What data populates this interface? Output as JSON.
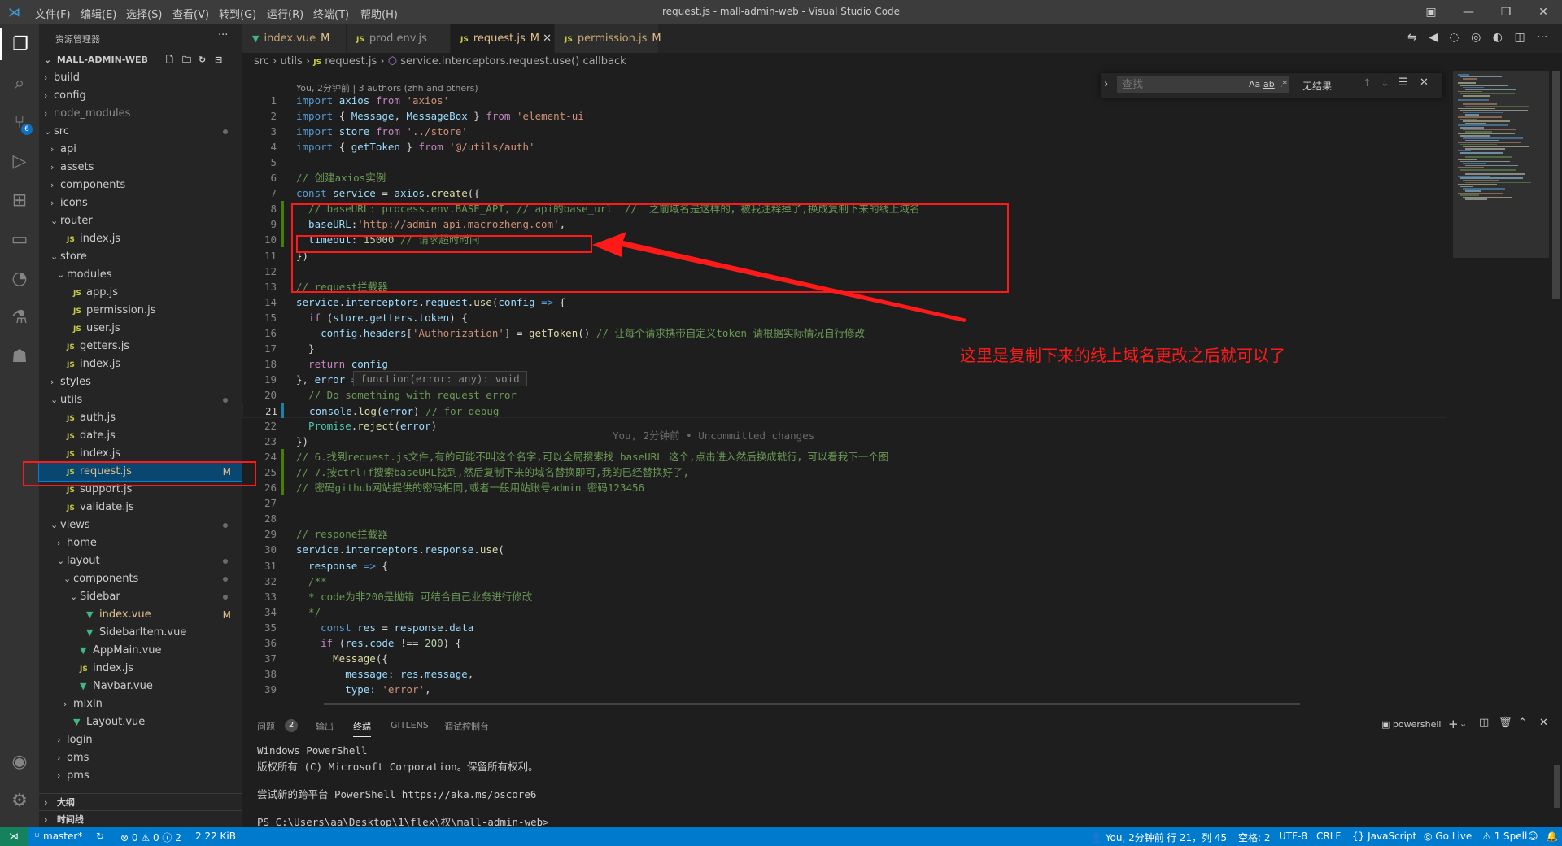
{
  "titlebar": {
    "menu": [
      "文件(F)",
      "编辑(E)",
      "选择(S)",
      "查看(V)",
      "转到(G)",
      "运行(R)",
      "终端(T)",
      "帮助(H)"
    ],
    "title": "request.js - mall-admin-web - Visual Studio Code"
  },
  "activitybar": {
    "icons": [
      "explorer-icon",
      "search-icon",
      "source-control-icon",
      "run-debug-icon",
      "extensions-icon",
      "remote-explorer-icon",
      "gitlens-icon",
      "testing-icon",
      "docker-icon"
    ],
    "scm_badge": "6",
    "bottom_icons": [
      "account-icon",
      "manage-gear-icon"
    ]
  },
  "sidebar": {
    "title": "资源管理器",
    "root": "MALL-ADMIN-WEB",
    "items": [
      {
        "label": "build",
        "depth": 1,
        "type": "folder",
        "open": false
      },
      {
        "label": "config",
        "depth": 1,
        "type": "folder",
        "open": false
      },
      {
        "label": "node_modules",
        "depth": 1,
        "type": "folder",
        "open": false,
        "dim": true
      },
      {
        "label": "src",
        "depth": 1,
        "type": "folder",
        "open": true,
        "dot": true
      },
      {
        "label": "api",
        "depth": 2,
        "type": "folder",
        "open": false
      },
      {
        "label": "assets",
        "depth": 2,
        "type": "folder",
        "open": false
      },
      {
        "label": "components",
        "depth": 2,
        "type": "folder",
        "open": false
      },
      {
        "label": "icons",
        "depth": 2,
        "type": "folder",
        "open": false
      },
      {
        "label": "router",
        "depth": 2,
        "type": "folder",
        "open": true
      },
      {
        "label": "index.js",
        "depth": 3,
        "type": "js"
      },
      {
        "label": "store",
        "depth": 2,
        "type": "folder",
        "open": true
      },
      {
        "label": "modules",
        "depth": 3,
        "type": "folder",
        "open": true
      },
      {
        "label": "app.js",
        "depth": 4,
        "type": "js"
      },
      {
        "label": "permission.js",
        "depth": 4,
        "type": "js"
      },
      {
        "label": "user.js",
        "depth": 4,
        "type": "js"
      },
      {
        "label": "getters.js",
        "depth": 3,
        "type": "js"
      },
      {
        "label": "index.js",
        "depth": 3,
        "type": "js"
      },
      {
        "label": "styles",
        "depth": 2,
        "type": "folder",
        "open": false
      },
      {
        "label": "utils",
        "depth": 2,
        "type": "folder",
        "open": true,
        "dot": true
      },
      {
        "label": "auth.js",
        "depth": 3,
        "type": "js"
      },
      {
        "label": "date.js",
        "depth": 3,
        "type": "js"
      },
      {
        "label": "index.js",
        "depth": 3,
        "type": "js"
      },
      {
        "label": "request.js",
        "depth": 3,
        "type": "js",
        "status": "M",
        "selected": true
      },
      {
        "label": "support.js",
        "depth": 3,
        "type": "js"
      },
      {
        "label": "validate.js",
        "depth": 3,
        "type": "js"
      },
      {
        "label": "views",
        "depth": 2,
        "type": "folder",
        "open": true,
        "dot": true
      },
      {
        "label": "home",
        "depth": 3,
        "type": "folder",
        "open": false
      },
      {
        "label": "layout",
        "depth": 3,
        "type": "folder",
        "open": true,
        "dot": true
      },
      {
        "label": "components",
        "depth": 4,
        "type": "folder",
        "open": true,
        "dot": true
      },
      {
        "label": "Sidebar",
        "depth": 5,
        "type": "folder",
        "open": true,
        "dot": true
      },
      {
        "label": "index.vue",
        "depth": 6,
        "type": "vue",
        "status": "M"
      },
      {
        "label": "SidebarItem.vue",
        "depth": 6,
        "type": "vue"
      },
      {
        "label": "AppMain.vue",
        "depth": 5,
        "type": "vue"
      },
      {
        "label": "index.js",
        "depth": 5,
        "type": "js"
      },
      {
        "label": "Navbar.vue",
        "depth": 5,
        "type": "vue"
      },
      {
        "label": "mixin",
        "depth": 4,
        "type": "folder",
        "open": false
      },
      {
        "label": "Layout.vue",
        "depth": 4,
        "type": "vue"
      },
      {
        "label": "login",
        "depth": 3,
        "type": "folder",
        "open": false
      },
      {
        "label": "oms",
        "depth": 3,
        "type": "folder",
        "open": false
      },
      {
        "label": "pms",
        "depth": 3,
        "type": "folder",
        "open": false
      }
    ],
    "outline_label": "大纲",
    "timeline_label": "时间线"
  },
  "tabs": [
    {
      "label": "index.vue",
      "type": "vue",
      "status": "M"
    },
    {
      "label": "prod.env.js",
      "type": "js",
      "status": ""
    },
    {
      "label": "request.js",
      "type": "js",
      "status": "M",
      "active": true
    },
    {
      "label": "permission.js",
      "type": "js",
      "status": "M"
    }
  ],
  "breadcrumb": {
    "parts": [
      "src",
      "utils",
      "request.js",
      "service.interceptors.request.use() callback"
    ]
  },
  "find": {
    "placeholder": "查找",
    "result": "无结果",
    "options": [
      "Aa",
      "ab",
      ".*"
    ]
  },
  "editor": {
    "blame": "You, 2分钟前 | 3 authors (zhh and others)",
    "current_line": 21,
    "inline_blame": "You, 2分钟前 • Uncommitted changes",
    "hover_hint": "function(error: any): void",
    "lines": [
      [
        [
          "k",
          "import "
        ],
        [
          "v",
          "axios "
        ],
        [
          "kw2",
          "from "
        ],
        [
          "s",
          "'axios'"
        ]
      ],
      [
        [
          "k",
          "import "
        ],
        [
          "p",
          "{ "
        ],
        [
          "v",
          "Message"
        ],
        [
          "p",
          ", "
        ],
        [
          "v",
          "MessageBox "
        ],
        [
          "p",
          "} "
        ],
        [
          "kw2",
          "from "
        ],
        [
          "s",
          "'element-ui'"
        ]
      ],
      [
        [
          "k",
          "import "
        ],
        [
          "v",
          "store "
        ],
        [
          "kw2",
          "from "
        ],
        [
          "s",
          "'../store'"
        ]
      ],
      [
        [
          "k",
          "import "
        ],
        [
          "p",
          "{ "
        ],
        [
          "v",
          "getToken "
        ],
        [
          "p",
          "} "
        ],
        [
          "kw2",
          "from "
        ],
        [
          "s",
          "'@/utils/auth'"
        ]
      ],
      [],
      [
        [
          "c",
          "// 创建axios实例"
        ]
      ],
      [
        [
          "k",
          "const "
        ],
        [
          "v",
          "service "
        ],
        [
          "p",
          "= "
        ],
        [
          "v",
          "axios"
        ],
        [
          "p",
          "."
        ],
        [
          "f",
          "create"
        ],
        [
          "p",
          "({"
        ]
      ],
      [
        [
          "c",
          "  // baseURL: process.env.BASE_API, // api的base_url  //  之前域名是这样的，被我注释掉了,换成复制下来的线上域名"
        ]
      ],
      [
        [
          "v",
          "  baseURL"
        ],
        [
          "p",
          ":"
        ],
        [
          "s",
          "'http://admin-api.macrozheng.com'"
        ],
        [
          "p",
          ","
        ]
      ],
      [
        [
          "v",
          "  timeout"
        ],
        [
          "p",
          ": "
        ],
        [
          "n",
          "15000 "
        ],
        [
          "c",
          "// 请求超时时间"
        ]
      ],
      [
        [
          "p",
          "})"
        ]
      ],
      [],
      [
        [
          "c",
          "// request拦截器"
        ]
      ],
      [
        [
          "v",
          "service"
        ],
        [
          "p",
          "."
        ],
        [
          "v",
          "interceptors"
        ],
        [
          "p",
          "."
        ],
        [
          "v",
          "request"
        ],
        [
          "p",
          "."
        ],
        [
          "f",
          "use"
        ],
        [
          "p",
          "("
        ],
        [
          "v",
          "config "
        ],
        [
          "k",
          "=> "
        ],
        [
          "p",
          "{"
        ]
      ],
      [
        [
          "kw2",
          "  if "
        ],
        [
          "p",
          "("
        ],
        [
          "v",
          "store"
        ],
        [
          "p",
          "."
        ],
        [
          "v",
          "getters"
        ],
        [
          "p",
          "."
        ],
        [
          "v",
          "token"
        ],
        [
          "p",
          ") {"
        ]
      ],
      [
        [
          "v",
          "    config"
        ],
        [
          "p",
          "."
        ],
        [
          "v",
          "headers"
        ],
        [
          "p",
          "["
        ],
        [
          "s",
          "'Authorization'"
        ],
        [
          "p",
          "] = "
        ],
        [
          "f",
          "getToken"
        ],
        [
          "p",
          "() "
        ],
        [
          "c",
          "// 让每个请求携带自定义token 请根据实际情况自行修改"
        ]
      ],
      [
        [
          "p",
          "  }"
        ]
      ],
      [
        [
          "kw2",
          "  return "
        ],
        [
          "v",
          "config"
        ]
      ],
      [
        [
          "p",
          "}, "
        ],
        [
          "v",
          "error "
        ],
        [
          "k",
          "=> "
        ],
        [
          "p",
          "{"
        ]
      ],
      [
        [
          "c",
          "  // Do something with request error"
        ]
      ],
      [
        [
          "v",
          "  console"
        ],
        [
          "p",
          "."
        ],
        [
          "f",
          "log"
        ],
        [
          "p",
          "("
        ],
        [
          "v",
          "error"
        ],
        [
          "p",
          ") "
        ],
        [
          "c",
          "// for debug"
        ]
      ],
      [
        [
          "t",
          "  Promise"
        ],
        [
          "p",
          "."
        ],
        [
          "f",
          "reject"
        ],
        [
          "p",
          "("
        ],
        [
          "v",
          "error"
        ],
        [
          "p",
          ")"
        ]
      ],
      [
        [
          "p",
          "})"
        ]
      ],
      [
        [
          "c",
          "// 6.找到request.js文件,有的可能不叫这个名字,可以全局搜索找 baseURL 这个,点击进入然后换成就行，可以看我下一个图"
        ]
      ],
      [
        [
          "c",
          "// 7.按ctrl+f搜索baseURL找到,然后复制下来的域名替换即可,我的已经替换好了,"
        ]
      ],
      [
        [
          "c",
          "// 密码github网站提供的密码相同,或者一般用站账号admin 密码123456"
        ]
      ],
      [],
      [],
      [
        [
          "c",
          "// respone拦截器"
        ]
      ],
      [
        [
          "v",
          "service"
        ],
        [
          "p",
          "."
        ],
        [
          "v",
          "interceptors"
        ],
        [
          "p",
          "."
        ],
        [
          "v",
          "response"
        ],
        [
          "p",
          "."
        ],
        [
          "f",
          "use"
        ],
        [
          "p",
          "("
        ]
      ],
      [
        [
          "v",
          "  response "
        ],
        [
          "k",
          "=> "
        ],
        [
          "p",
          "{"
        ]
      ],
      [
        [
          "c",
          "  /**"
        ]
      ],
      [
        [
          "c",
          "  * code为非200是抛错 可结合自己业务进行修改"
        ]
      ],
      [
        [
          "c",
          "  */"
        ]
      ],
      [
        [
          "k",
          "    const "
        ],
        [
          "v",
          "res "
        ],
        [
          "p",
          "= "
        ],
        [
          "v",
          "response"
        ],
        [
          "p",
          "."
        ],
        [
          "v",
          "data"
        ]
      ],
      [
        [
          "kw2",
          "    if "
        ],
        [
          "p",
          "("
        ],
        [
          "v",
          "res"
        ],
        [
          "p",
          "."
        ],
        [
          "v",
          "code "
        ],
        [
          "p",
          "!== "
        ],
        [
          "n",
          "200"
        ],
        [
          "p",
          ") {"
        ]
      ],
      [
        [
          "f",
          "      Message"
        ],
        [
          "p",
          "({"
        ]
      ],
      [
        [
          "v",
          "        message"
        ],
        [
          "p",
          ": "
        ],
        [
          "v",
          "res"
        ],
        [
          "p",
          "."
        ],
        [
          "v",
          "message"
        ],
        [
          "p",
          ","
        ]
      ],
      [
        [
          "v",
          "        type"
        ],
        [
          "p",
          ": "
        ],
        [
          "s",
          "'error'"
        ],
        [
          "p",
          ","
        ]
      ]
    ]
  },
  "annotation": {
    "text": "这里是复制下来的线上域名更改之后就可以了"
  },
  "panel": {
    "tabs": [
      "问题",
      "输出",
      "终端",
      "GITLENS",
      "调试控制台"
    ],
    "problems_count": "2",
    "active_tab": "终端",
    "terminal_name": "powershell",
    "terminal_lines": [
      "Windows PowerShell",
      "版权所有 (C) Microsoft Corporation。保留所有权利。",
      "",
      "尝试新的跨平台 PowerShell https://aka.ms/pscore6",
      "",
      "PS C:\\Users\\aa\\Desktop\\1\\flex\\权\\mall-admin-web>"
    ]
  },
  "statusbar": {
    "branch": "master*",
    "errors": "0",
    "warnings": "0",
    "info": "2",
    "size": "2.22 KiB",
    "blame": "You, 2分钟前",
    "position": "行 21，列 45",
    "spaces": "空格: 2",
    "encoding": "UTF-8",
    "eol": "CRLF",
    "language": "JavaScript",
    "golive": "Go Live",
    "spell": "1 Spell"
  },
  "colors": {
    "accent": "#007acc",
    "annotation_red": "#ff1a1a",
    "modified": "#e2c08d"
  }
}
